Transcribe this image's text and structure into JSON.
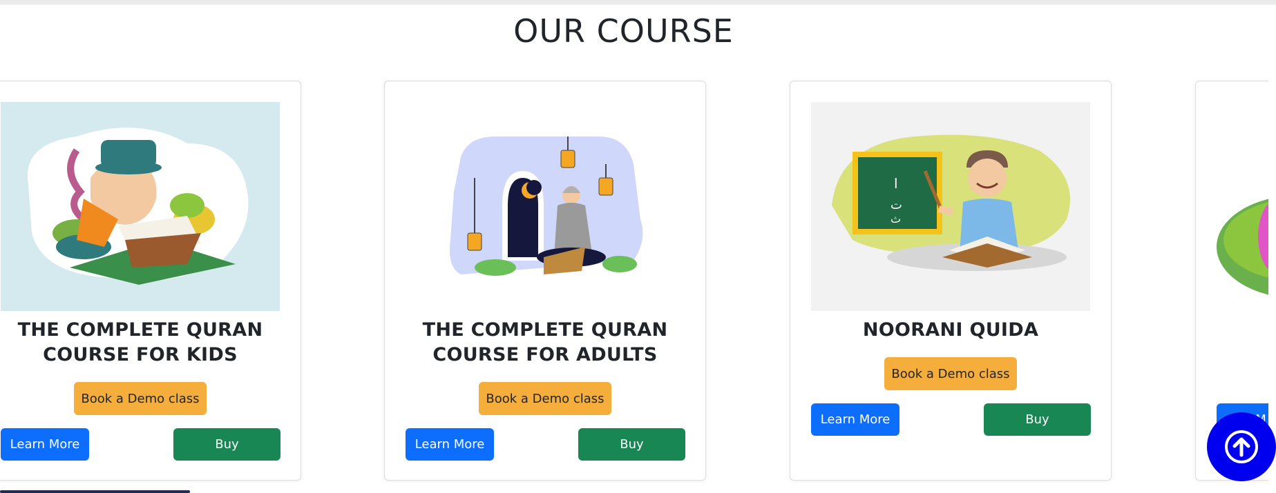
{
  "section": {
    "title": "OUR COURSE"
  },
  "cards": [
    {
      "title_line1": "THE COMPLETE QURAN",
      "title_line2": "COURSE FOR KIDS",
      "demo_label": "Book a Demo class",
      "learn_label": "Learn More",
      "buy_label": "Buy"
    },
    {
      "title_line1": "THE COMPLETE QURAN",
      "title_line2": "COURSE FOR ADULTS",
      "demo_label": "Book a Demo class",
      "learn_label": "Learn More",
      "buy_label": "Buy"
    },
    {
      "title_line1": "NOORANI QUIDA",
      "title_line2": "",
      "demo_label": "Book a Demo class",
      "learn_label": "Learn More",
      "buy_label": "Buy"
    },
    {
      "title_line1": "",
      "title_line2": "",
      "demo_label": "",
      "learn_label": "M",
      "buy_label": ""
    }
  ],
  "icons": {
    "scroll_top": "arrow-up-circle-icon"
  },
  "colors": {
    "demo_button": "#f5ad3b",
    "learn_button": "#0d6efd",
    "buy_button": "#198754",
    "scroll_top": "#0000ee"
  }
}
